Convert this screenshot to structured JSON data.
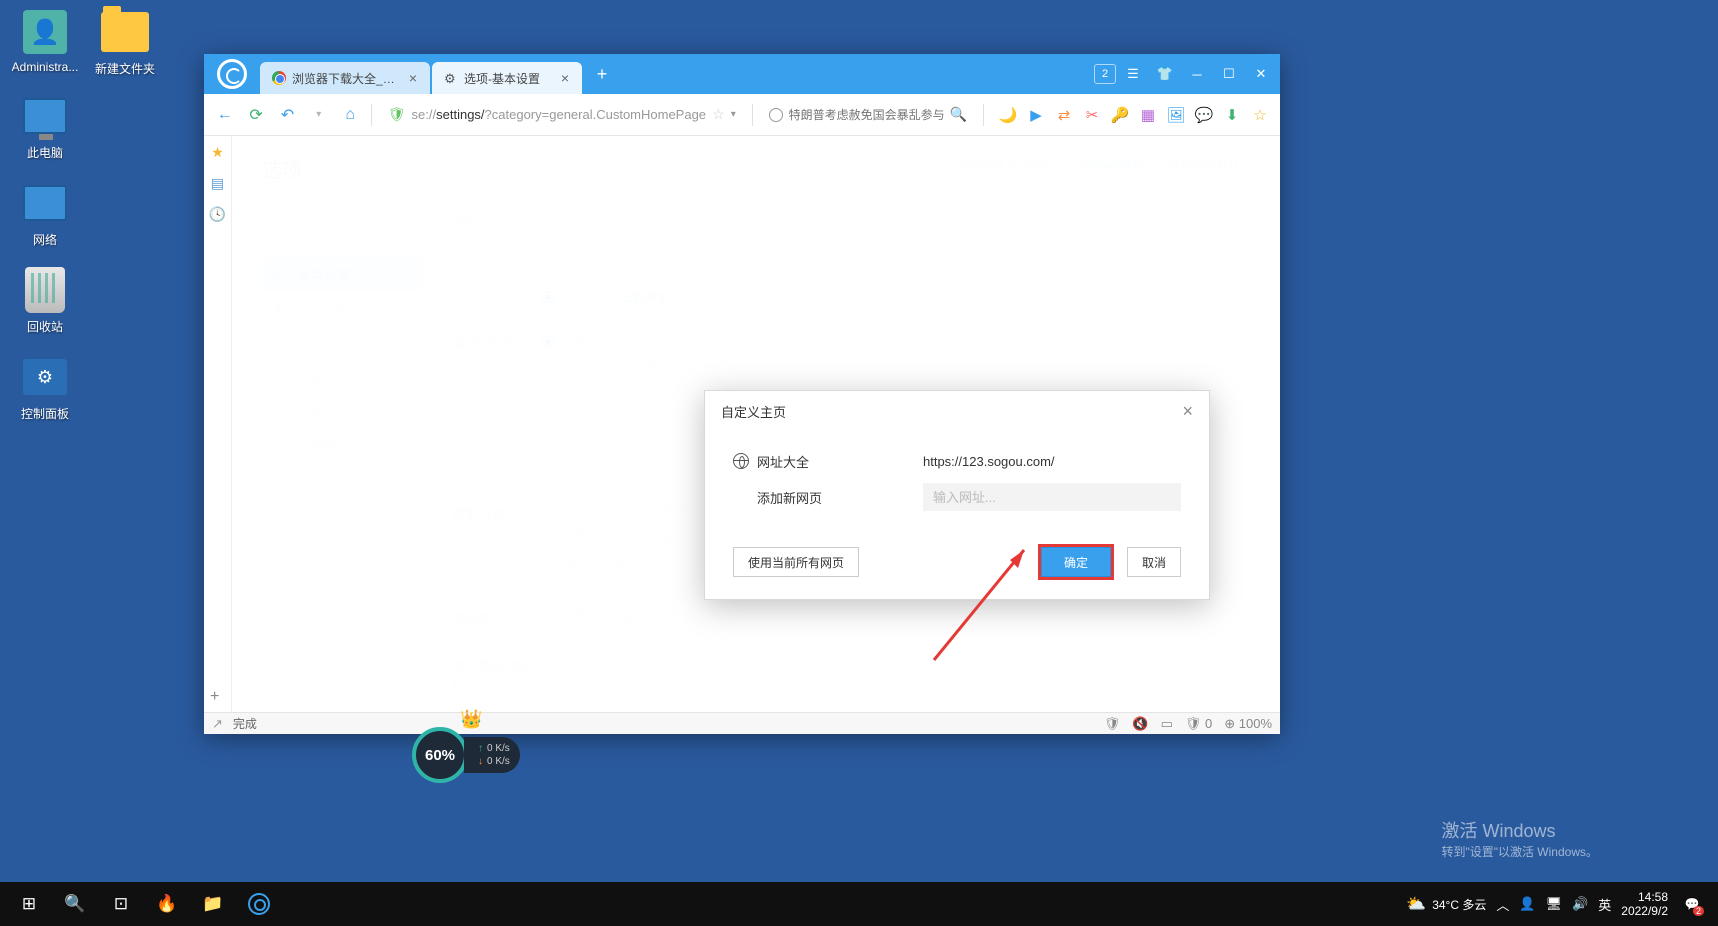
{
  "desktop": {
    "icons": [
      {
        "label": "Administra...",
        "kind": "person"
      },
      {
        "label": "此电脑",
        "kind": "pc"
      },
      {
        "label": "网络",
        "kind": "net"
      },
      {
        "label": "回收站",
        "kind": "trash"
      },
      {
        "label": "控制面板",
        "kind": "cp"
      }
    ],
    "icons2": [
      {
        "label": "新建文件夹",
        "kind": "folder"
      }
    ]
  },
  "browser": {
    "tabs": [
      {
        "label": "浏览器下载大全_浏览器",
        "favicon": "chrome"
      },
      {
        "label": "选项-基本设置",
        "favicon": "gear"
      }
    ],
    "window_badge": "2",
    "address": {
      "proto": "se://",
      "host": "settings/",
      "path": "?category=general.CustomHomePage"
    },
    "search_placeholder": "特朗普考虑赦免国会暴乱参与",
    "page_title": "选项",
    "top_links": [
      "内核切换  本页默认",
      "Internet选项",
      "恢复本页默认"
    ],
    "settings_nav": [
      {
        "icon": "⚙",
        "label": "基本设置",
        "active": true
      },
      {
        "icon": "◧",
        "label": "标签设置"
      },
      {
        "icon": "🛡",
        "label": "安全设置"
      },
      {
        "icon": "⬇",
        "label": "下载"
      },
      {
        "icon": "⌨",
        "label": "鼠标手势"
      },
      {
        "icon": "⌨",
        "label": "快捷键"
      },
      {
        "icon": "≡",
        "label": "高级"
      },
      {
        "icon": "⊞",
        "label": "扩展管理"
      },
      {
        "icon": "⋯",
        "label": "实验室"
      }
    ],
    "sections": {
      "homepage_label": "主页",
      "homepage_opts": [
        "网址大全",
        "我的最爱",
        "空白页",
        "自定义"
      ],
      "homepage_link": "设置网址",
      "startup_label": "启动时打开",
      "startup_opts": [
        "主页",
        "上次关闭时的页面"
      ],
      "search_label": "搜索引擎",
      "search_opts": [
        "地址栏搜索引擎与搜索栏一致",
        "启用搜索栏的热词推荐功能"
      ],
      "search_manage": "管理搜索引擎",
      "addrbar_label": "地址栏",
      "addrbar_opt": "启用地址栏粘贴复制功能",
      "smart_label": "动态智能地址栏",
      "smart_opts": [
        "开启动态智能地址栏推荐功能",
        "使用动态智能地址栏时，推荐内容来自于："
      ]
    },
    "modal": {
      "title": "自定义主页",
      "row1_label": "网址大全",
      "row1_value": "https://123.sogou.com/",
      "row2_label": "添加新网页",
      "row2_placeholder": "输入网址...",
      "btn_all": "使用当前所有网页",
      "btn_ok": "确定",
      "btn_cancel": "取消"
    },
    "status_done": "完成",
    "status_zoom": "100%",
    "status_badge": "0"
  },
  "gadget": {
    "pct": "60%",
    "up": "0 K/s",
    "down": "0 K/s"
  },
  "watermark": {
    "title": "激活 Windows",
    "sub": "转到\"设置\"以激活 Windows。"
  },
  "taskbar": {
    "weather_temp": "34°C 多云",
    "ime": "英",
    "time": "14:58",
    "date": "2022/9/2",
    "notif_count": "2"
  }
}
